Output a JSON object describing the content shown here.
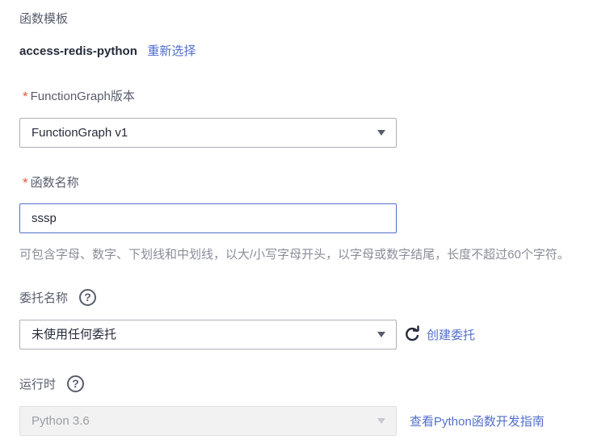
{
  "template_section": {
    "label": "函数模板",
    "template_name": "access-redis-python",
    "reselect_link": "重新选择"
  },
  "version_field": {
    "required_mark": "*",
    "label": "FunctionGraph版本",
    "selected_value": "FunctionGraph v1"
  },
  "name_field": {
    "required_mark": "*",
    "label": "函数名称",
    "value": "sssp",
    "hint": "可包含字母、数字、下划线和中划线，以大/小写字母开头，以字母或数字结尾，长度不超过60个字符。"
  },
  "agency_field": {
    "label": "委托名称",
    "help_icon": "?",
    "selected_value": "未使用任何委托",
    "refresh_icon": "refresh-icon",
    "create_link": "创建委托"
  },
  "runtime_field": {
    "label": "运行时",
    "help_icon": "?",
    "selected_value": "Python 3.6",
    "disabled": true,
    "guide_link": "查看Python函数开发指南"
  },
  "colors": {
    "link": "#526ecc",
    "required": "#e4574b",
    "focus_border": "#526ecc",
    "disabled_bg": "#f2f2f3"
  }
}
